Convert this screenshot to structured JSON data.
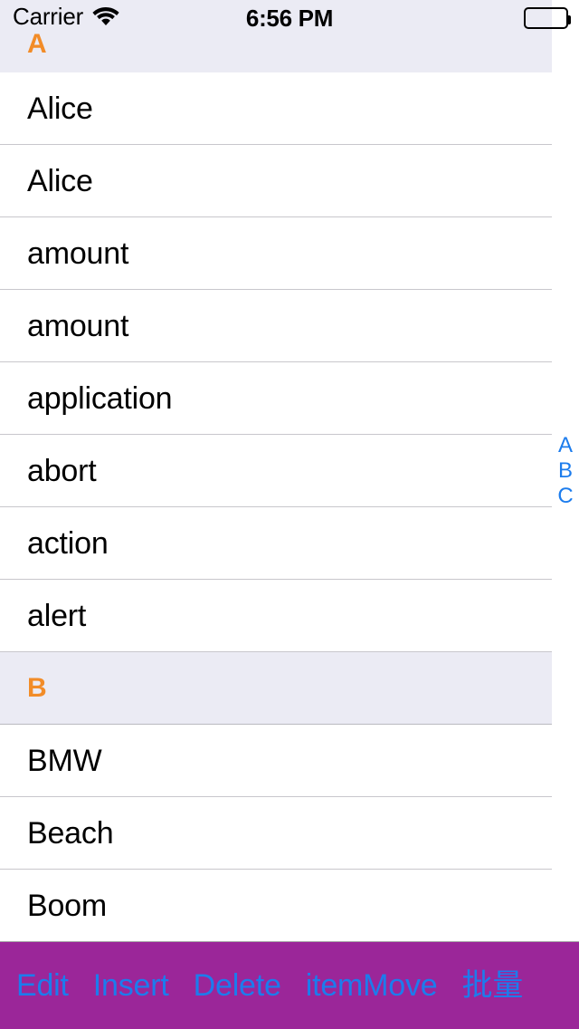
{
  "status_bar": {
    "carrier": "Carrier",
    "wifi_icon": "wifi-icon",
    "time": "6:56 PM",
    "battery_icon": "battery-full-icon"
  },
  "list": {
    "sections": [
      {
        "title": "A",
        "rows": [
          {
            "label": "Alice"
          },
          {
            "label": "Alice"
          },
          {
            "label": "amount"
          },
          {
            "label": "amount"
          },
          {
            "label": "application"
          },
          {
            "label": "abort"
          },
          {
            "label": "action"
          },
          {
            "label": "alert"
          }
        ]
      },
      {
        "title": "B",
        "rows": [
          {
            "label": "BMW"
          },
          {
            "label": "Beach"
          },
          {
            "label": "Boom"
          }
        ]
      }
    ]
  },
  "index_bar": {
    "letters": [
      "A",
      "B",
      "C"
    ]
  },
  "toolbar": {
    "items": [
      {
        "label": "Edit"
      },
      {
        "label": "Insert"
      },
      {
        "label": "Delete"
      },
      {
        "label": "itemMove"
      },
      {
        "label": "批量"
      }
    ]
  },
  "colors": {
    "section_header_bg": "#EBEBF4",
    "section_header_text": "#F28C28",
    "toolbar_bg": "#9B2699",
    "tint_blue": "#1C7CED",
    "separator": "#C8C7CC"
  }
}
